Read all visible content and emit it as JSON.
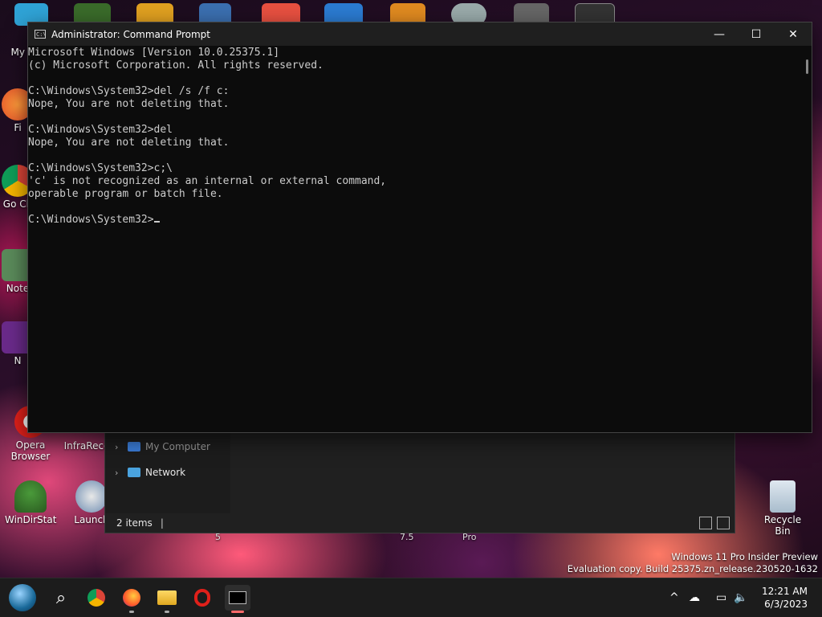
{
  "desktop": {
    "icons_left": [
      {
        "label": "My Co",
        "name": "my-computer-desktop-icon"
      },
      {
        "label": "Fi",
        "name": "firefox-desktop-icon"
      },
      {
        "label": "Go Ch",
        "name": "google-chrome-desktop-icon"
      },
      {
        "label": "Note",
        "name": "notepad-desktop-icon"
      },
      {
        "label": "N",
        "name": "n-app-desktop-icon"
      },
      {
        "label": "Opera Browser",
        "name": "opera-browser-desktop-icon"
      },
      {
        "label": "WinDirStat",
        "name": "windirstat-desktop-icon"
      }
    ],
    "icons_mid": [
      {
        "label": "InfraReco",
        "name": "infrareco-desktop-icon"
      },
      {
        "label": "Launch",
        "name": "launch-desktop-icon"
      }
    ],
    "recycle_bin": {
      "label": "Recycle Bin"
    },
    "stray_labels": [
      "5",
      "7.5",
      "Pro"
    ],
    "watermark": {
      "line1": "Windows 11 Pro Insider Preview",
      "line2": "Evaluation copy. Build 25375.zn_release.230520-1632"
    }
  },
  "explorer": {
    "nav_items": [
      {
        "label": "My Computer",
        "color": "#3a7bd5"
      },
      {
        "label": "Network",
        "color": "#4aa3df"
      }
    ],
    "status_text": "2 items",
    "status_sep": "|"
  },
  "cmd": {
    "title": "Administrator: Command Prompt",
    "app_icon_text": "C:\\",
    "controls": {
      "minimize": "—",
      "maximize": "☐",
      "close": "✕"
    },
    "lines": [
      "Microsoft Windows [Version 10.0.25375.1]",
      "(c) Microsoft Corporation. All rights reserved.",
      "",
      "C:\\Windows\\System32>del /s /f c:",
      "Nope, You are not deleting that.",
      "",
      "C:\\Windows\\System32>del",
      "Nope, You are not deleting that.",
      "",
      "C:\\Windows\\System32>c;\\",
      "'c' is not recognized as an internal or external command,",
      "operable program or batch file.",
      ""
    ],
    "prompt": "C:\\Windows\\System32>"
  },
  "taskbar": {
    "apps": [
      {
        "name": "start-button",
        "icon": "start-orb-icon"
      },
      {
        "name": "search-button",
        "icon": "search-icon",
        "glyph": "⌕"
      },
      {
        "name": "chrome-taskbar-button",
        "icon": "chrome-icon"
      },
      {
        "name": "firefox-taskbar-button",
        "icon": "firefox-icon"
      },
      {
        "name": "file-explorer-taskbar-button",
        "icon": "folder-icon"
      },
      {
        "name": "opera-taskbar-button",
        "icon": "opera-icon"
      },
      {
        "name": "terminal-taskbar-button",
        "icon": "terminal-icon"
      }
    ],
    "tray": {
      "chevron": "^",
      "onedrive": "☁",
      "network": "▭",
      "volume": "🔈"
    },
    "clock": {
      "time": "12:21 AM",
      "date": "6/3/2023"
    }
  }
}
